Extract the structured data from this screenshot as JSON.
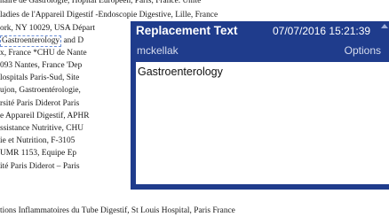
{
  "document": {
    "lines": [
      "naire de Gastrologie, Hôpital Européen, Paris, France. Unité",
      "ladies de l'Appareil Digestif -Endoscopie Digestive, Lille, France",
      "ork, NY 10029, USA Départ",
      "Gastroenterology",
      "and D",
      "x, France *CHU de Nante",
      "093 Nantes, France 'Dep",
      "lospitals Paris-Sud, Site",
      "ujon, Gastroentérologie,",
      "rsité Paris Diderot Paris",
      "e Appareil Digestif, APHR",
      "ssistance Nutritive, CHU",
      "ie et Nutrition, F-3105",
      "UMR 1153, Equipe Ep",
      "ité Paris Diderot – Paris",
      "tions Inflammatoires du Tube Digestif, St Louis Hospital, Paris France"
    ]
  },
  "popup": {
    "title": "Replacement Text",
    "date": "07/07/2016 15:21:39",
    "user": "mckellak",
    "options_label": "Options",
    "body_text": "Gastroenterology"
  }
}
